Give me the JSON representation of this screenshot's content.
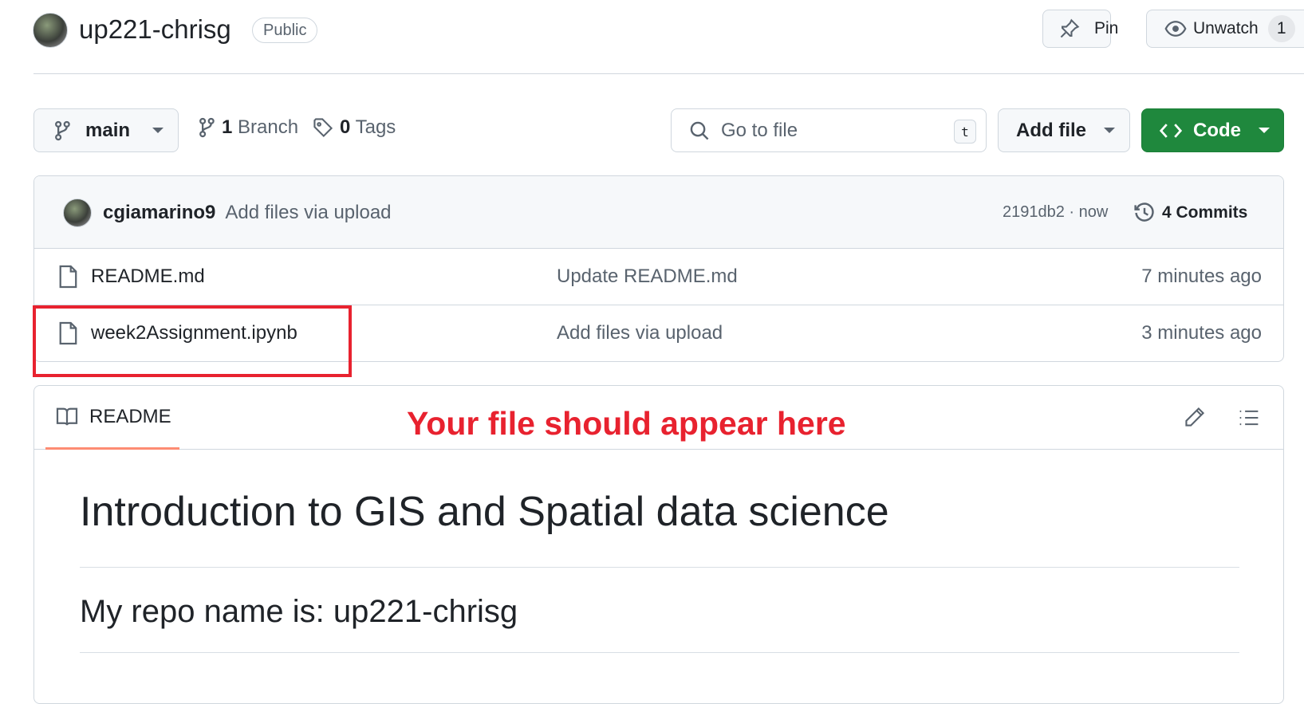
{
  "repo": {
    "name": "up221-chrisg",
    "visibility": "Public"
  },
  "header_actions": {
    "pin": "Pin",
    "unwatch": "Unwatch",
    "watch_count": "1"
  },
  "toolbar": {
    "branch": "main",
    "branches": "1 Branch",
    "branches_count": "1",
    "branches_label": "Branch",
    "tags_count": "0",
    "tags_label": "Tags",
    "search_placeholder": "Go to file",
    "search_shortcut": "t",
    "add_file": "Add file",
    "code": "Code"
  },
  "latest_commit": {
    "author": "cgiamarino9",
    "message": "Add files via upload",
    "sha": "2191db2",
    "time": "now",
    "commits": "4 Commits"
  },
  "files": [
    {
      "name": "README.md",
      "message": "Update README.md",
      "time": "7 minutes ago"
    },
    {
      "name": "week2Assignment.ipynb",
      "message": "Add files via upload",
      "time": "3 minutes ago"
    }
  ],
  "annotation": {
    "text": "Your file should appear here",
    "color": "#e8222f"
  },
  "readme": {
    "tab": "README",
    "h1": "Introduction to GIS and Spatial data science",
    "h2": "My repo name is: up221-chrisg"
  },
  "colors": {
    "primary": "#1f883d",
    "underline": "#fd8c73"
  }
}
